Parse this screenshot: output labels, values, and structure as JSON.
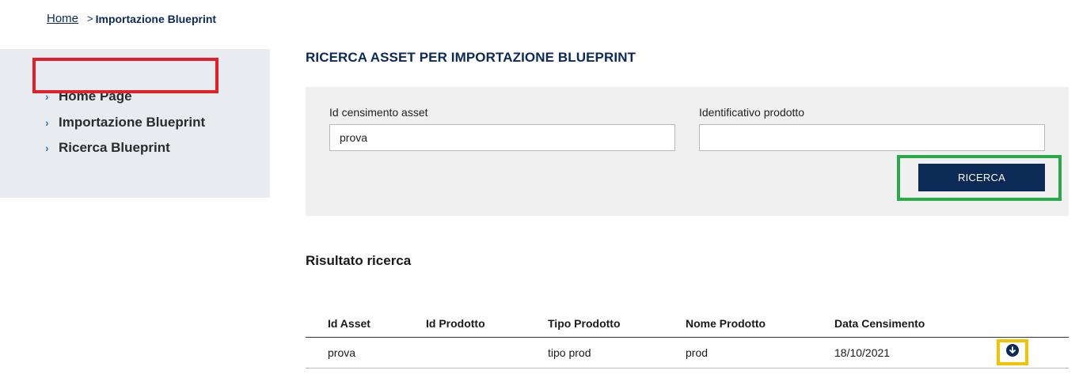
{
  "breadcrumb": {
    "home": "Home",
    "separator": ">",
    "current": "Importazione Blueprint"
  },
  "sidebar": {
    "items": [
      {
        "label": "Home Page",
        "icon": "chevron-right-icon"
      },
      {
        "label": "Importazione Blueprint",
        "icon": "chevron-right-icon",
        "highlighted": true
      },
      {
        "label": "Ricerca Blueprint",
        "icon": "chevron-right-icon"
      }
    ]
  },
  "page": {
    "title": "RICERCA ASSET PER IMPORTAZIONE BLUEPRINT"
  },
  "search": {
    "asset_id_label": "Id censimento asset",
    "asset_id_value": "prova",
    "product_id_label": "Identificativo prodotto",
    "product_id_value": "",
    "button_label": "RICERCA"
  },
  "results": {
    "title": "Risultato ricerca",
    "columns": [
      "Id Asset",
      "Id Prodotto",
      "Tipo Prodotto",
      "Nome Prodotto",
      "Data Censimento"
    ],
    "rows": [
      {
        "id_asset": "prova",
        "id_prodotto": "",
        "tipo_prodotto": "tipo prod",
        "nome_prodotto": "prod",
        "data_censimento": "18/10/2021",
        "action_icon": "download-icon"
      }
    ]
  },
  "colors": {
    "brand": "#0b2a55",
    "accent_chevron": "#3a78c4",
    "highlight_red": "#e0202a",
    "highlight_green": "#2aa84a",
    "highlight_yellow": "#f2c300"
  }
}
